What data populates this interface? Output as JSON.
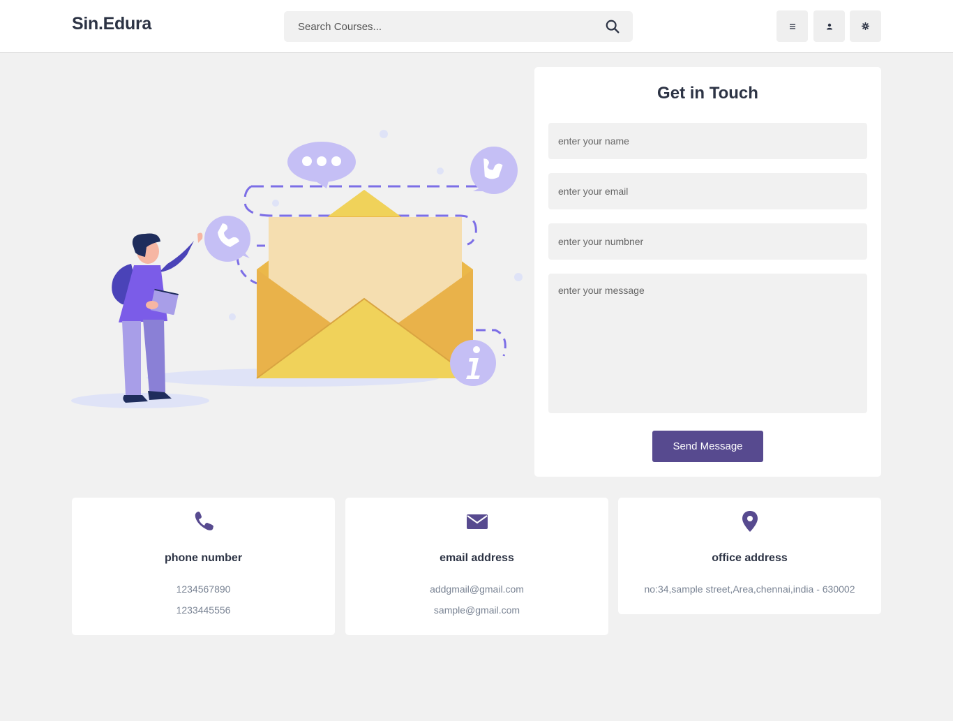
{
  "header": {
    "logo": "Sin.Edura",
    "search_placeholder": "Search Courses...",
    "icons": [
      "search-icon",
      "menu-icon",
      "user-icon",
      "settings-icon"
    ]
  },
  "contact_form": {
    "title": "Get in Touch",
    "name_placeholder": "enter your name",
    "email_placeholder": "enter your email",
    "number_placeholder": "enter your numbner",
    "message_placeholder": "enter your message",
    "send_label": "Send Message"
  },
  "info_cards": [
    {
      "icon": "phone-icon",
      "title": "phone number",
      "lines": [
        "1234567890",
        "1233445556"
      ]
    },
    {
      "icon": "envelope-icon",
      "title": "email address",
      "lines": [
        "addgmail@gmail.com",
        "sample@gmail.com"
      ]
    },
    {
      "icon": "map-pin-icon",
      "title": "office address",
      "lines": [
        "no:34,sample street,Area,chennai,india - 630002"
      ]
    }
  ],
  "colors": {
    "accent": "#574a8f",
    "background": "#f1f1f1",
    "card": "#ffffff",
    "envelope_yellow": "#f0d25a",
    "illustration_purple": "#7c6ee6"
  }
}
